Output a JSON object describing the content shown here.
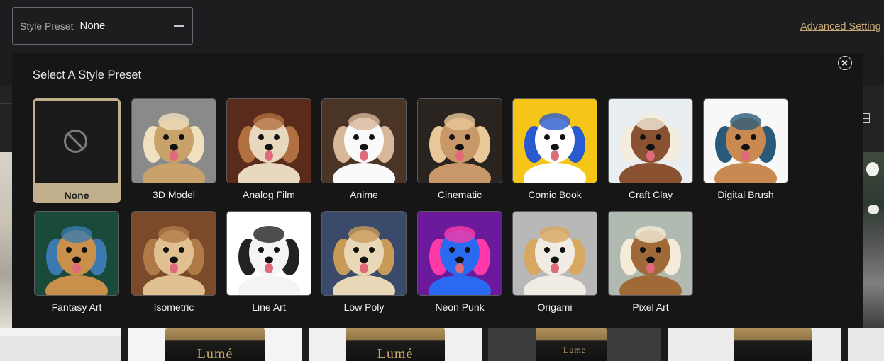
{
  "topbar": {
    "style_preset_label": "Style Preset",
    "style_preset_value": "None",
    "advanced_settings_link": "Advanced Setting"
  },
  "modal": {
    "title": "Select A Style Preset",
    "close_icon": "close-icon",
    "presets": [
      {
        "label": "None",
        "selected": true,
        "icon": "none-icon"
      },
      {
        "label": "3D Model",
        "colors": [
          "#8a8a8a",
          "#c8a26a",
          "#f0e0c0"
        ]
      },
      {
        "label": "Analog Film",
        "colors": [
          "#5a2a1a",
          "#e8d8c0",
          "#b07040"
        ]
      },
      {
        "label": "Anime",
        "colors": [
          "#4a3426",
          "#fafafa",
          "#d8b89a"
        ]
      },
      {
        "label": "Cinematic",
        "colors": [
          "#2a2420",
          "#c89868",
          "#e8c898"
        ]
      },
      {
        "label": "Comic Book",
        "colors": [
          "#f5c518",
          "#ffffff",
          "#2a5ad0"
        ]
      },
      {
        "label": "Craft Clay",
        "colors": [
          "#e8eef2",
          "#8a5230",
          "#f4ecdc"
        ]
      },
      {
        "label": "Digital Brush",
        "colors": [
          "#f8f8f8",
          "#c88a50",
          "#2a5a7a"
        ]
      },
      {
        "label": "Fantasy Art",
        "colors": [
          "#1a4a3a",
          "#c8904a",
          "#3a7ab0"
        ]
      },
      {
        "label": "Isometric",
        "colors": [
          "#7a4a2a",
          "#e0c090",
          "#b07a48"
        ]
      },
      {
        "label": "Line Art",
        "colors": [
          "#ffffff",
          "#f4f4f4",
          "#222222"
        ]
      },
      {
        "label": "Low Poly",
        "colors": [
          "#3a4a6a",
          "#e8d8b8",
          "#c89a58"
        ]
      },
      {
        "label": "Neon Punk",
        "colors": [
          "#6a1a9a",
          "#2a6af0",
          "#ff3aa8"
        ]
      },
      {
        "label": "Origami",
        "colors": [
          "#b8b8b8",
          "#f0ece4",
          "#d8a860"
        ]
      },
      {
        "label": "Pixel Art",
        "colors": [
          "#b0bab0",
          "#a06a38",
          "#f4ecd8"
        ]
      }
    ]
  },
  "background": {
    "product_text": [
      "Lumé",
      "Lumé",
      "Lumé",
      "Lume",
      ""
    ]
  }
}
